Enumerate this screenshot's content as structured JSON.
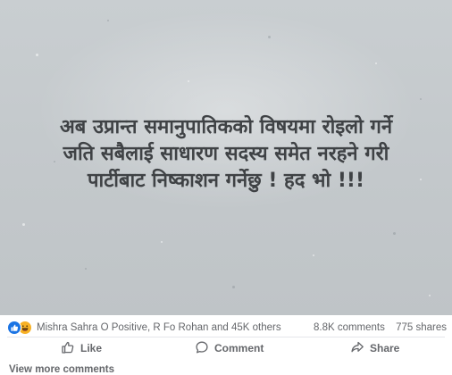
{
  "post": {
    "text_lines": [
      "अब उप्रान्त समानुपातिकको विषयमा रोइलो गर्ने",
      "जति सबैलाई साधारण सदस्य समेत नरहने गरी",
      "पार्टीबाट निष्काशन गर्नेछु ! हद भो !!!"
    ],
    "background_color": "#c6cbce",
    "text_color": "#3f4245"
  },
  "reactions": {
    "icons": [
      "like-reaction-icon",
      "haha-reaction-icon"
    ],
    "like_color": "#1b74e4",
    "haha_color": "#f7b125",
    "summary": "Mishra Sahra O Positive, R Fo Rohan and 45K others"
  },
  "counts": {
    "comments": "8.8K comments",
    "shares": "775 shares"
  },
  "actions": {
    "like": "Like",
    "comment": "Comment",
    "share": "Share"
  },
  "comments": {
    "view_more": "View more comments"
  }
}
